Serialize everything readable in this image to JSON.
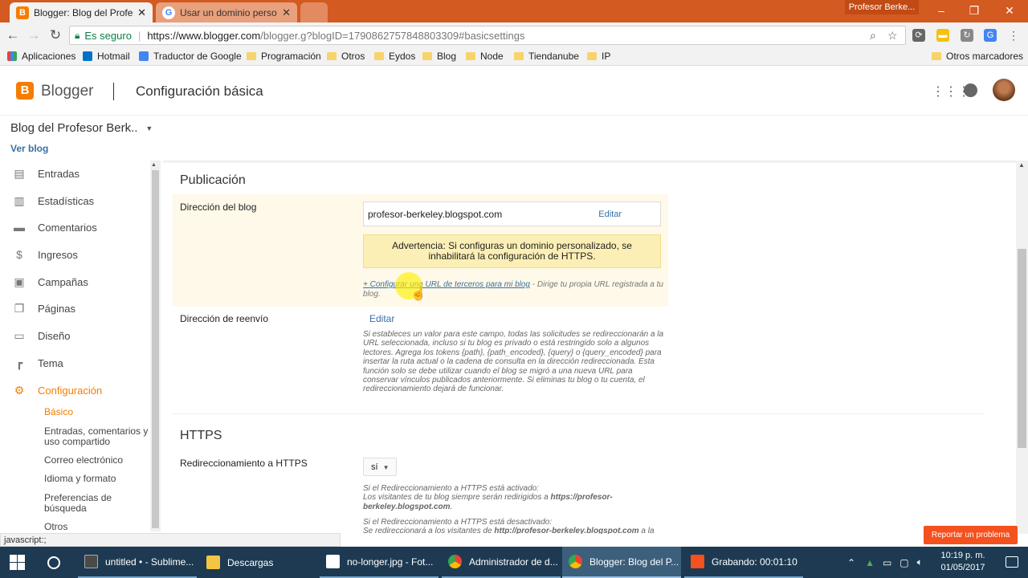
{
  "browser": {
    "tabs": [
      {
        "title": "Blogger: Blog del Profesor Berkeley",
        "favicon": "blogger-icon"
      },
      {
        "title": "Usar un dominio personalizado",
        "favicon": "google-icon"
      }
    ],
    "profile": "Profesor Berke...",
    "secure_label": "Es seguro",
    "url_host": "https://www.blogger.com",
    "url_path": "/blogger.g?blogID=1790862757848803309#basicsettings"
  },
  "bookmarks": [
    {
      "label": "Aplicaciones",
      "icon": "apps-icon"
    },
    {
      "label": "Hotmail",
      "icon": "hotmail-icon"
    },
    {
      "label": "Traductor de Google",
      "icon": "translate-icon"
    },
    {
      "label": "Programación",
      "icon": "folder-icon"
    },
    {
      "label": "Otros",
      "icon": "folder-icon"
    },
    {
      "label": "Eydos",
      "icon": "folder-icon"
    },
    {
      "label": "Blog",
      "icon": "folder-icon"
    },
    {
      "label": "Node",
      "icon": "folder-icon"
    },
    {
      "label": "Tiendanube",
      "icon": "folder-icon"
    },
    {
      "label": "IP",
      "icon": "folder-icon"
    }
  ],
  "other_bookmarks": "Otros marcadores",
  "header": {
    "app_name": "Blogger",
    "page_title": "Configuración básica"
  },
  "blog": {
    "name": "Blog del Profesor Berk..",
    "view_link": "Ver blog"
  },
  "sidebar": {
    "items": [
      {
        "label": "Entradas",
        "icon": "posts-icon"
      },
      {
        "label": "Estadísticas",
        "icon": "stats-icon"
      },
      {
        "label": "Comentarios",
        "icon": "comments-icon"
      },
      {
        "label": "Ingresos",
        "icon": "dollar-icon"
      },
      {
        "label": "Campañas",
        "icon": "campaigns-icon"
      },
      {
        "label": "Páginas",
        "icon": "pages-icon"
      },
      {
        "label": "Diseño",
        "icon": "layout-icon"
      },
      {
        "label": "Tema",
        "icon": "theme-icon"
      },
      {
        "label": "Configuración",
        "icon": "gear-icon",
        "active": true
      }
    ],
    "subitems": [
      {
        "label": "Básico",
        "active": true
      },
      {
        "label": "Entradas, comentarios y uso compartido"
      },
      {
        "label": "Correo electrónico"
      },
      {
        "label": "Idioma y formato"
      },
      {
        "label": "Preferencias de búsqueda"
      },
      {
        "label": "Otros"
      }
    ]
  },
  "publicacion": {
    "section_title": "Publicación",
    "address_label": "Dirección del blog",
    "address_value": "profesor-berkeley.blogspot.com",
    "edit_label": "Editar",
    "warning": "Advertencia: Si configuras un dominio personalizado, se inhabilitará la configuración de HTTPS.",
    "custom_url_link": "+ Configurar una URL de terceros para mi blog",
    "custom_url_desc": " - Dirige tu propia URL registrada a tu blog.",
    "redirect_label": "Dirección de reenvío",
    "redirect_edit": "Editar",
    "redirect_help": "Si estableces un valor para este campo, todas las solicitudes se redireccionarán a la URL seleccionada, incluso si tu blog es privado o está restringido solo a algunos lectores. Agrega los tokens {path}, {path_encoded}, {query} o {query_encoded} para insertar la ruta actual o la cadena de consulta en la dirección redireccionada. Esta función solo se debe utilizar cuando el blog se migró a una nueva URL para conservar vínculos publicados anteriormente. Si eliminas tu blog o tu cuenta, el redireccionamiento dejará de funcionar."
  },
  "https": {
    "section_title": "HTTPS",
    "redirect_label": "Redireccionamiento a HTTPS",
    "select_value": "sí",
    "help_on_title": "Si el Redireccionamiento a HTTPS está activado:",
    "help_on_pre": "Los visitantes de tu blog siempre serán redirigidos a ",
    "help_on_url": "https://profesor-berkeley.blogspot.com",
    "help_on_post": ".",
    "help_off_title": "Si el Redireccionamiento a HTTPS está desactivado:",
    "help_off_pre": "Se redireccionará a los visitantes de ",
    "help_off_url": "http://profesor-berkeley.blogspot.com",
    "help_off_post": " a la versión HTTP, una conexión que no está encriptada. Se redireccionará a los"
  },
  "status_text": "javascript:;",
  "report_button": "Reportar un problema",
  "taskbar": {
    "items": [
      {
        "label": "untitled • - Sublime...",
        "icon": "sublime-icon"
      },
      {
        "label": "Descargas",
        "icon": "folder-icon"
      },
      {
        "label": "no-longer.jpg - Fot...",
        "icon": "photos-icon"
      },
      {
        "label": "Administrador de d...",
        "icon": "chrome-icon"
      },
      {
        "label": "Blogger: Blog del P...",
        "icon": "chrome-icon"
      },
      {
        "label": "Grabando:  00:01:10",
        "icon": "record-icon"
      }
    ],
    "time": "10:19 p. m.",
    "date": "01/05/2017"
  },
  "colors": {
    "accent": "#f57d00",
    "titlebar": "#d35a20",
    "link": "#3a6fa7",
    "taskbar": "#1d3a52",
    "warning_bg": "#fbefb5",
    "report": "#f4511e"
  }
}
